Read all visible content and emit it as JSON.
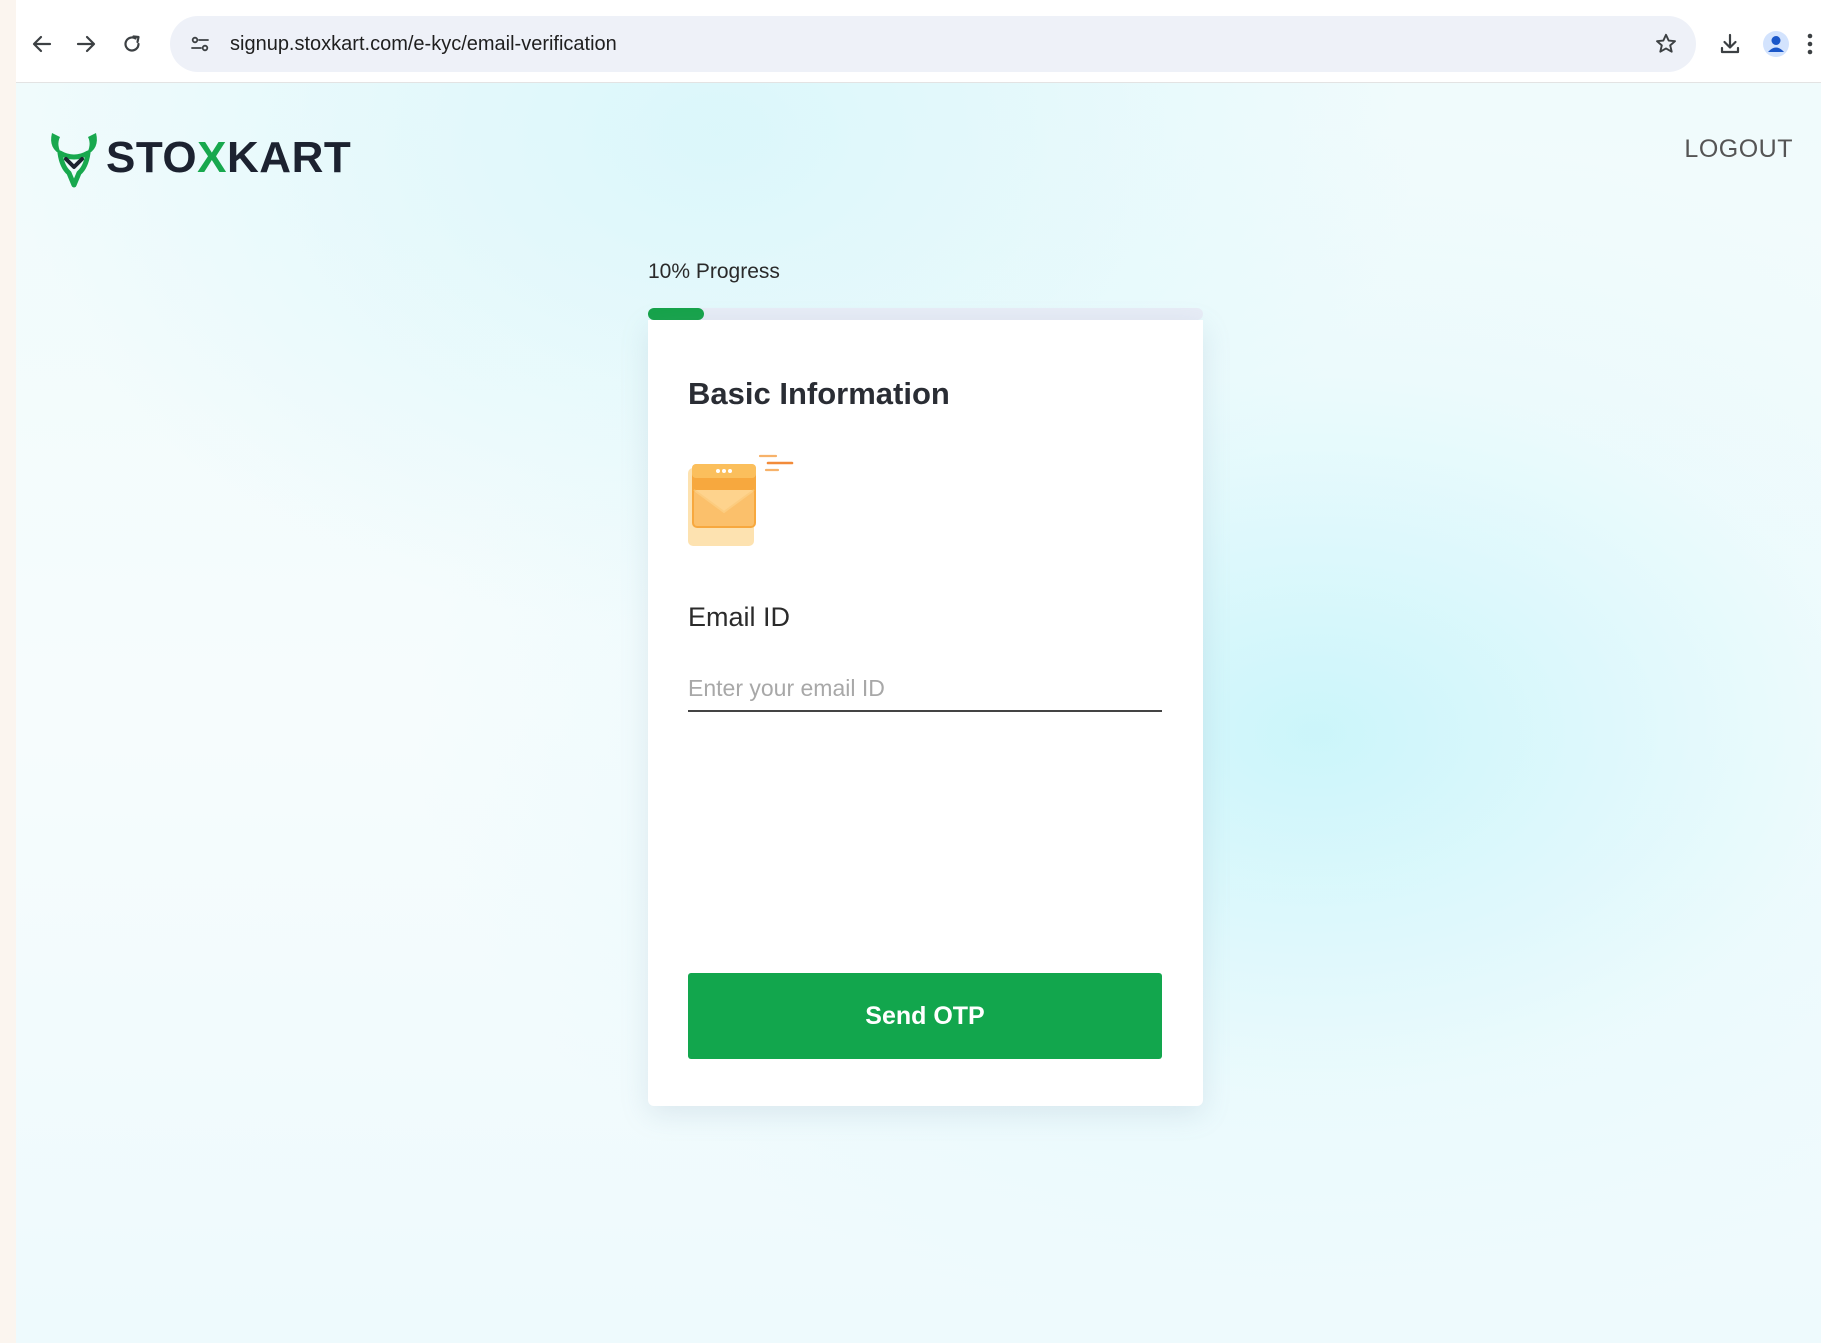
{
  "browser": {
    "url": "signup.stoxkart.com/e-kyc/email-verification",
    "icons": [
      "back-arrow-icon",
      "forward-arrow-icon",
      "reload-icon",
      "site-info-icon",
      "bookmark-star-icon",
      "download-icon",
      "profile-icon",
      "more-menu-icon"
    ]
  },
  "header": {
    "logo_part1": "STO",
    "logo_part2": "X",
    "logo_part3": "KART",
    "logout_label": "LOGOUT"
  },
  "progress": {
    "label": "10% Progress",
    "value": 0.1
  },
  "card": {
    "title": "Basic Information",
    "email_label": "Email ID",
    "email_placeholder": "Enter your email ID",
    "email_value": "",
    "submit_label": "Send OTP"
  },
  "colors": {
    "brand_green": "#12a64d",
    "progress_track": "#e7ecf6",
    "logo_dark": "#1c2230"
  }
}
